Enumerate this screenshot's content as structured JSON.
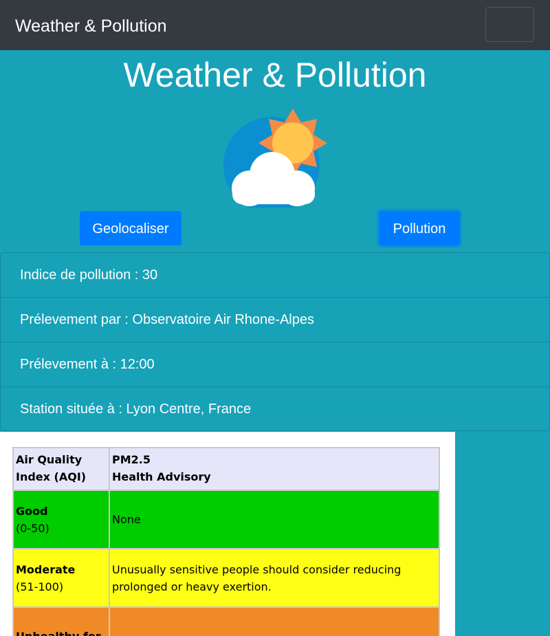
{
  "navbar": {
    "brand": "Weather & Pollution"
  },
  "page": {
    "title": "Weather & Pollution"
  },
  "buttons": {
    "geolocate": "Geolocaliser",
    "pollution": "Pollution"
  },
  "info_list": [
    "Indice de pollution : 30",
    "Prélevement par : Observatoire Air Rhone-Alpes",
    "Prélevement à : 12:00",
    "Station située à : Lyon Centre, France"
  ],
  "aqi_table": {
    "header": {
      "col1_line1": "Air Quality",
      "col1_line2": "Index  (AQI)",
      "col2_line1": "PM2.5",
      "col2_line2": "Health Advisory"
    },
    "rows": [
      {
        "level": "Good",
        "range": "(0-50)",
        "advisory": "None",
        "color": "#00cc00"
      },
      {
        "level": "Moderate",
        "range": "(51-100)",
        "advisory": "Unusually sensitive people should consider reducing prolonged or heavy exertion.",
        "color": "#ffff15"
      },
      {
        "level": "Unhealthy for",
        "range": "",
        "advisory": "",
        "color": "#ef8a27"
      }
    ]
  },
  "colors": {
    "navbar": "#343a40",
    "background": "#17a2b8",
    "button": "#007bff"
  }
}
